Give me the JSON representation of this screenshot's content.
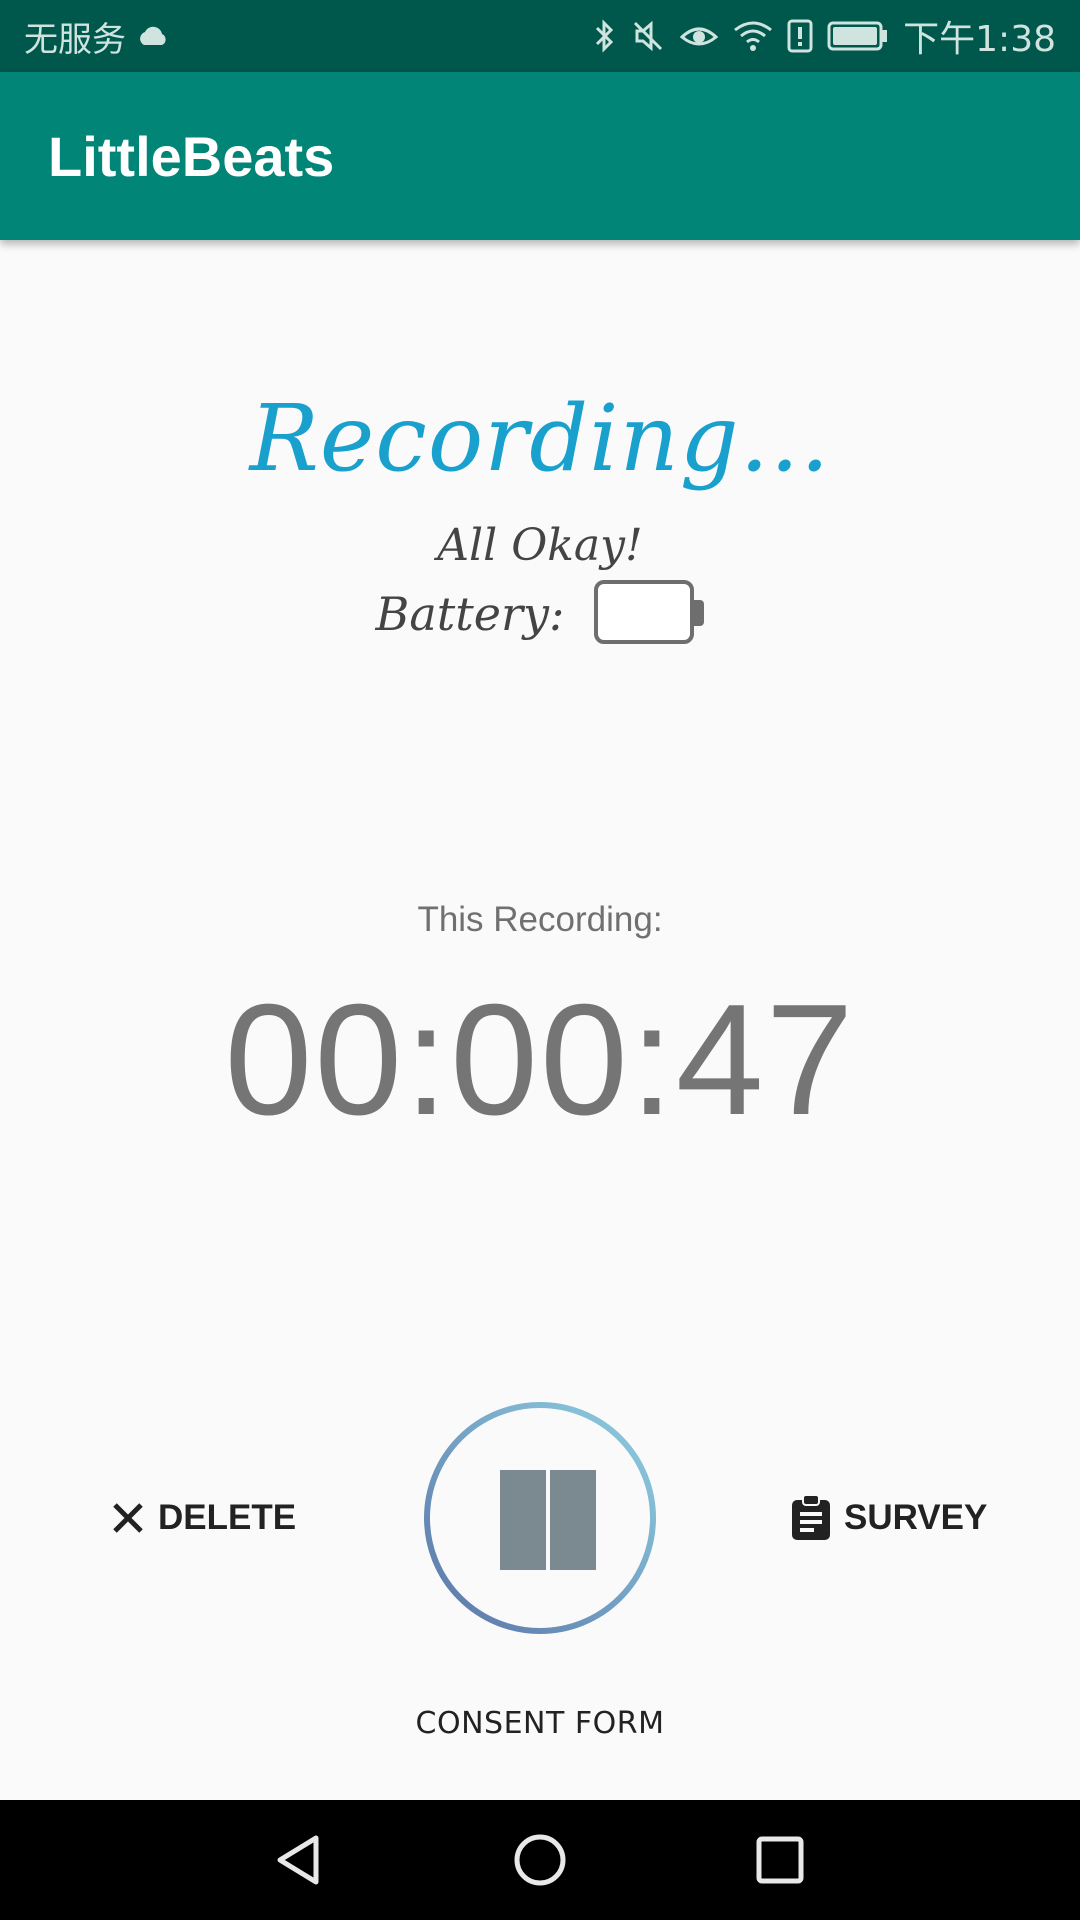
{
  "status_bar": {
    "carrier": "无服务",
    "time": "下午1:38",
    "icons": [
      "cloud-icon",
      "bluetooth-icon",
      "mute-icon",
      "eye-icon",
      "wifi-icon",
      "alert-icon",
      "battery-status-icon"
    ]
  },
  "app_bar": {
    "title": "LittleBeats"
  },
  "recording": {
    "headline": "Recording...",
    "status": "All Okay!",
    "battery_label": "Battery:",
    "battery_level": 0
  },
  "timer": {
    "label": "This Recording:",
    "value": "00:00:47"
  },
  "controls": {
    "delete_label": "DELETE",
    "survey_label": "SURVEY",
    "consent_label": "CONSENT FORM",
    "pause_icon": "pause-icon"
  },
  "nav_bar": {
    "icons": [
      "back-icon",
      "home-icon",
      "recents-icon"
    ]
  },
  "colors": {
    "status_bar": "#00574b",
    "app_bar": "#008577",
    "headline": "#1aa0cc",
    "background": "#fafafb"
  }
}
